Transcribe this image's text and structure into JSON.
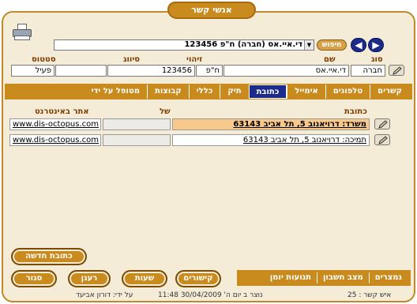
{
  "window": {
    "title": "אנשי קשר"
  },
  "toolbar": {
    "search_value": "די.איי.אס (חברה) ח\"פ 123456",
    "search_button": "חיפוש",
    "nav_prev": "◀",
    "nav_next": "▶"
  },
  "header": {
    "labels": {
      "type": "סוג",
      "name": "שם",
      "id": "זיהוי",
      "class": "סיווג",
      "status": "סטטוס"
    },
    "values": {
      "type": "חברה",
      "name": "די.איי.אס",
      "id_type": "ח\"פ",
      "id": "123456",
      "class": "",
      "status": "פעיל"
    }
  },
  "tabs": [
    "קשרים",
    "טלפונים",
    "אימייל",
    "כתובת",
    "תיק",
    "כללי",
    "קבוצות",
    "מטופל על ידי"
  ],
  "active_tab": "כתובת",
  "columns": {
    "address": "כתובת",
    "of": "של",
    "website": "אתר באינטרנט"
  },
  "addresses": [
    {
      "address": "משרד: דרויאנוב 5, תל אביב 63143",
      "of": "",
      "website": "www.dis-octopus.com"
    },
    {
      "address": "תמיכה: דרויאנוב 5, תל אביב 63143",
      "of": "",
      "website": "www.dis-octopus.com"
    }
  ],
  "buttons": {
    "new_address": "כתובת חדשה",
    "close": "סגור",
    "refresh": "רענן",
    "hours": "שעות",
    "links": "קישורים"
  },
  "bottom_tabs": [
    "נמצרים",
    "מצב חשבון",
    "תנועות יומן"
  ],
  "status": {
    "created": "נוצר ב יום ה' 30/04/2009 11:48",
    "by": "על ידי: דורון אביעד",
    "contact_count": "איש קשר : 25"
  }
}
